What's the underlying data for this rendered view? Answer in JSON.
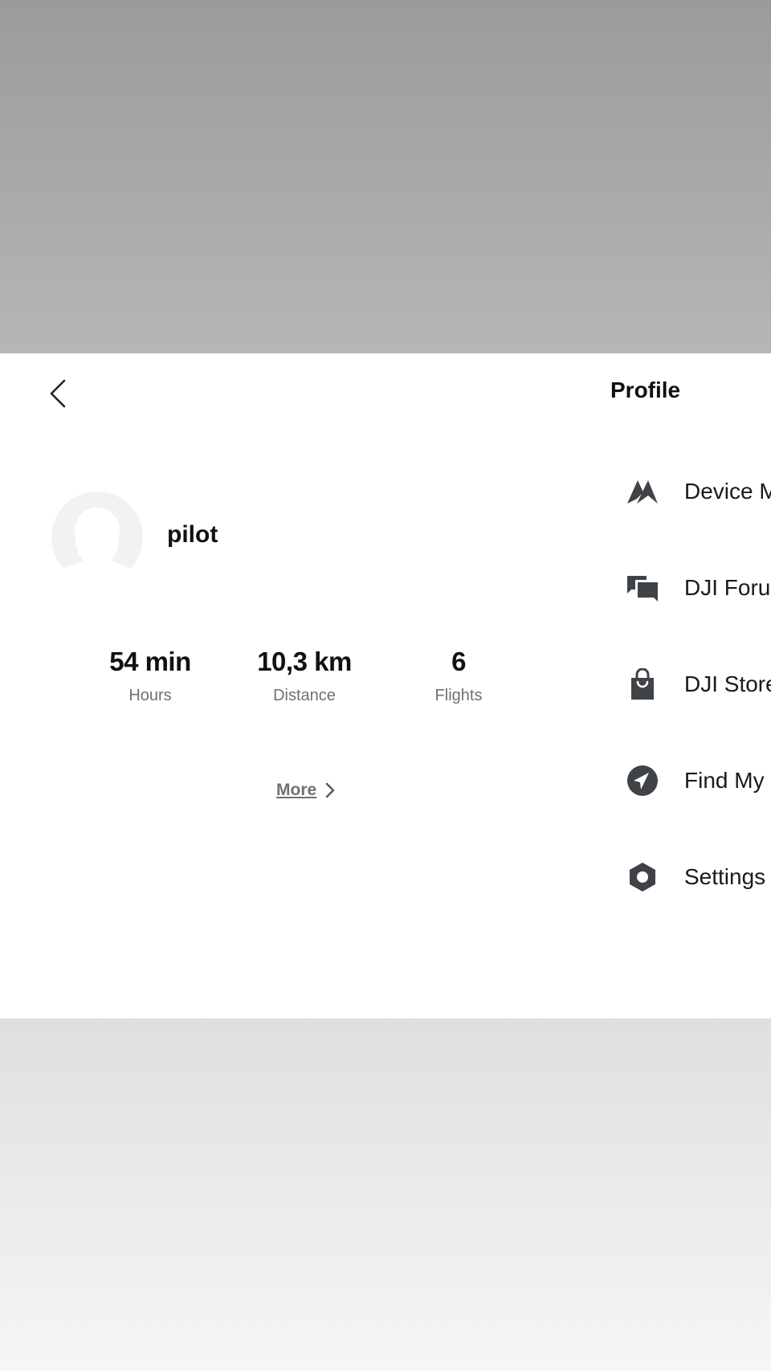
{
  "header": {
    "title": "Profile"
  },
  "profile": {
    "username": "pilot"
  },
  "stats": [
    {
      "value": "54 min",
      "label": "Hours"
    },
    {
      "value": "10,3 km",
      "label": "Distance"
    },
    {
      "value": "6",
      "label": "Flights"
    }
  ],
  "more": {
    "label": "More"
  },
  "menu": [
    {
      "label": "Device M",
      "icon": "device-management-icon"
    },
    {
      "label": "DJI Forur",
      "icon": "forum-chat-icon"
    },
    {
      "label": "DJI Store",
      "icon": "shopping-bag-icon"
    },
    {
      "label": "Find My",
      "icon": "find-my-compass-icon"
    },
    {
      "label": "Settings",
      "icon": "settings-hexagon-icon"
    }
  ],
  "colors": {
    "icon": "#3f4347",
    "label_gray": "#6f7173"
  }
}
